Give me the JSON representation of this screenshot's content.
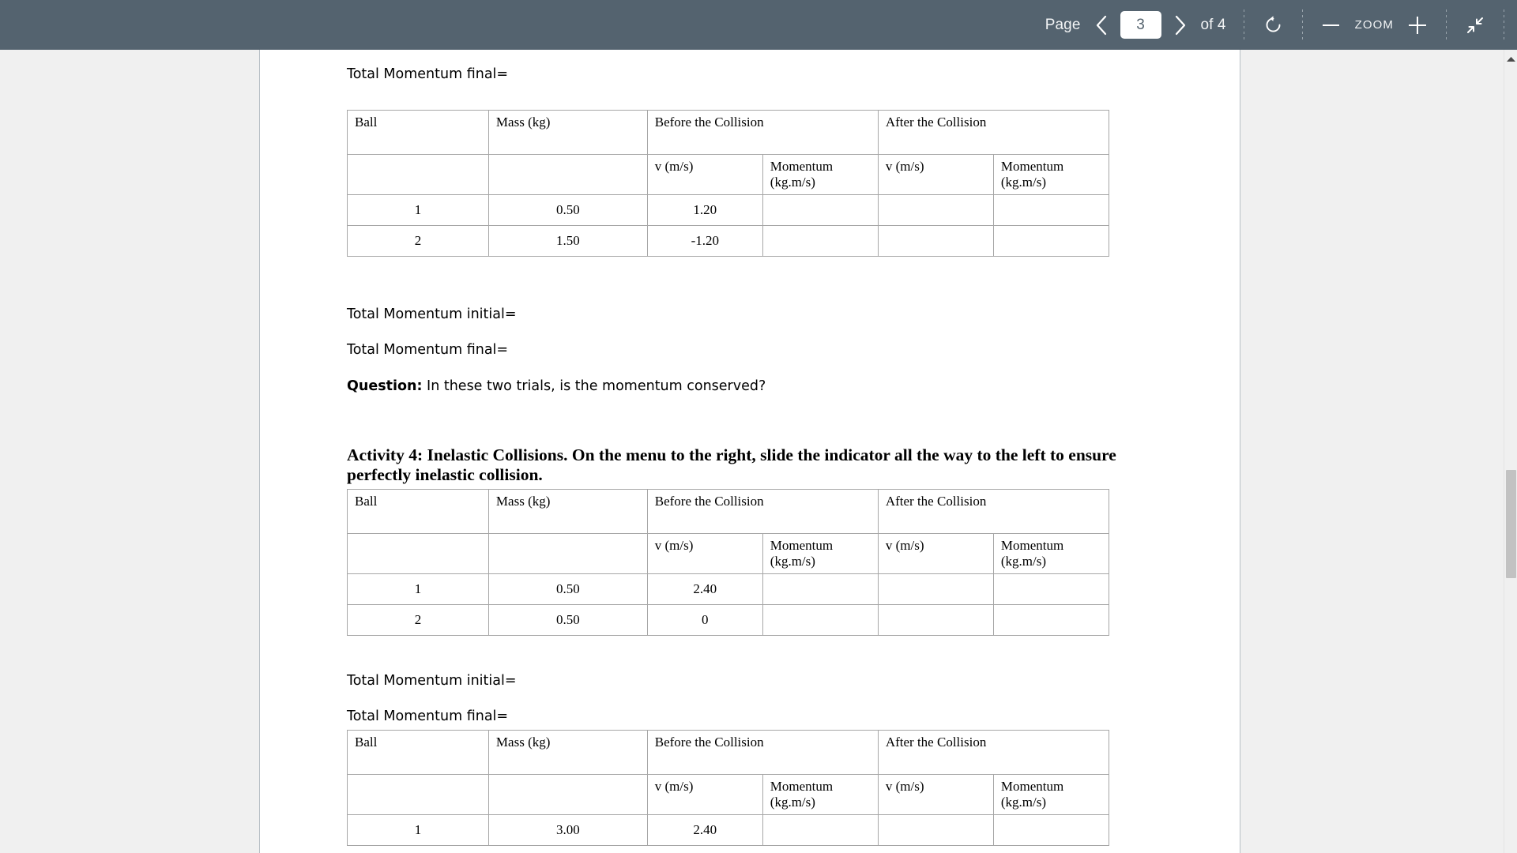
{
  "toolbar": {
    "page_label": "Page",
    "prev_icon": "chevron-left-icon",
    "page_number": "3",
    "next_icon": "chevron-right-icon",
    "total_pages": "of 4",
    "rotate_icon": "rotate-icon",
    "zoom_out_icon": "minus-icon",
    "zoom_label": "ZOOM",
    "zoom_in_icon": "plus-icon",
    "collapse_icon": "collapse-arrows-icon",
    "background_color": "#54636f",
    "text_color": "#f2f4f5"
  },
  "document": {
    "lines": {
      "momentum_final_1": "Total Momentum final=",
      "momentum_initial_2": "Total Momentum initial=",
      "momentum_final_2": "Total Momentum final=",
      "question_label": "Question:",
      "question_text": " In these two trials, is the momentum conserved?",
      "activity_heading": "Activity 4: Inelastic Collisions. On the menu to the right, slide the indicator all the way to the left to ensure perfectly inelastic collision.",
      "momentum_initial_3": "Total Momentum initial=",
      "momentum_final_3": "Total Momentum final="
    },
    "table_headers": {
      "ball": "Ball",
      "mass": "Mass (kg)",
      "before": "Before the Collision",
      "after": "After the Collision",
      "v_before": "v (m/s)",
      "momentum_before": "Momentum (kg.m/s)",
      "v_after": "v (m/s)",
      "momentum_after": "Momentum (kg.m/s)"
    },
    "tables": [
      {
        "id": "table-1",
        "rows": [
          {
            "ball": "1",
            "mass": "0.50",
            "v_before": "1.20",
            "momentum_before": "",
            "v_after": "",
            "momentum_after": ""
          },
          {
            "ball": "2",
            "mass": "1.50",
            "v_before": "-1.20",
            "momentum_before": "",
            "v_after": "",
            "momentum_after": ""
          }
        ]
      },
      {
        "id": "table-2",
        "rows": [
          {
            "ball": "1",
            "mass": "0.50",
            "v_before": "2.40",
            "momentum_before": "",
            "v_after": "",
            "momentum_after": ""
          },
          {
            "ball": "2",
            "mass": "0.50",
            "v_before": "0",
            "momentum_before": "",
            "v_after": "",
            "momentum_after": ""
          }
        ]
      },
      {
        "id": "table-3",
        "rows": [
          {
            "ball": "1",
            "mass": "3.00",
            "v_before": "2.40",
            "momentum_before": "",
            "v_after": "",
            "momentum_after": ""
          }
        ]
      }
    ]
  },
  "scrollbar": {
    "up_arrow_icon": "scroll-up-arrow-icon",
    "thumb": "scroll-thumb"
  }
}
